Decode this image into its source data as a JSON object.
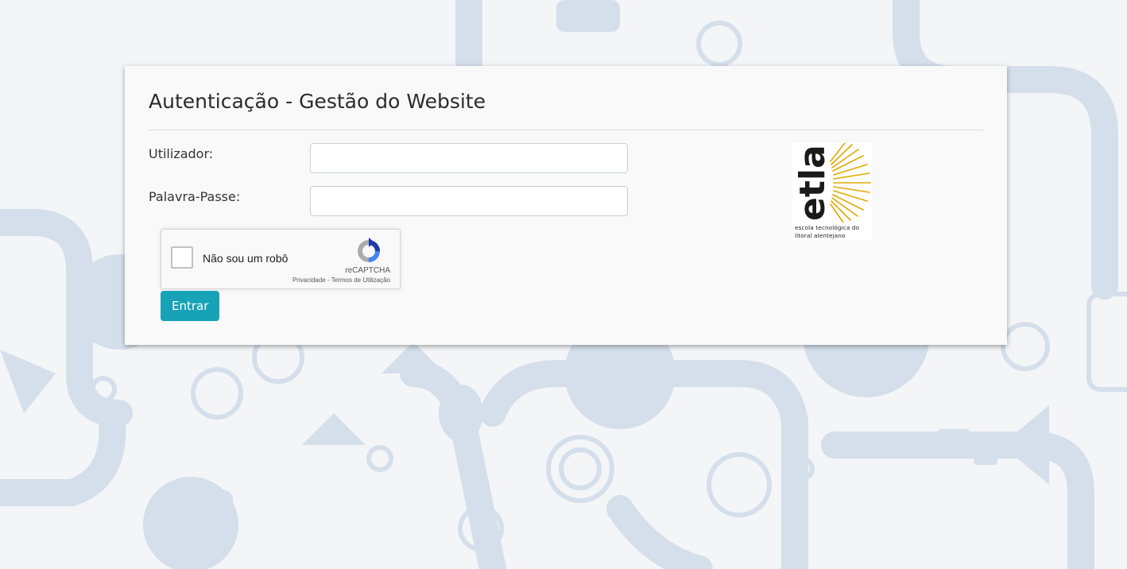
{
  "login": {
    "title": "Autenticação - Gestão do Website",
    "username_label": "Utilizador:",
    "username_value": "",
    "password_label": "Palavra-Passe:",
    "password_value": "",
    "submit_label": "Entrar"
  },
  "captcha": {
    "label": "Não sou um robô",
    "brand": "reCAPTCHA",
    "privacy_link": "Privacidade",
    "separator": " - ",
    "terms_link": "Termos de Utilização",
    "logo_icon": "recaptcha-icon"
  },
  "logo": {
    "wordmark": "etla",
    "line1": "escola tecnológica do",
    "line2": "litoral alentejano",
    "icon": "sun-logo-icon",
    "accent_color": "#e0a800"
  },
  "colors": {
    "primary_button": "#17a2b8",
    "background_pattern": "#d5e0ec"
  }
}
